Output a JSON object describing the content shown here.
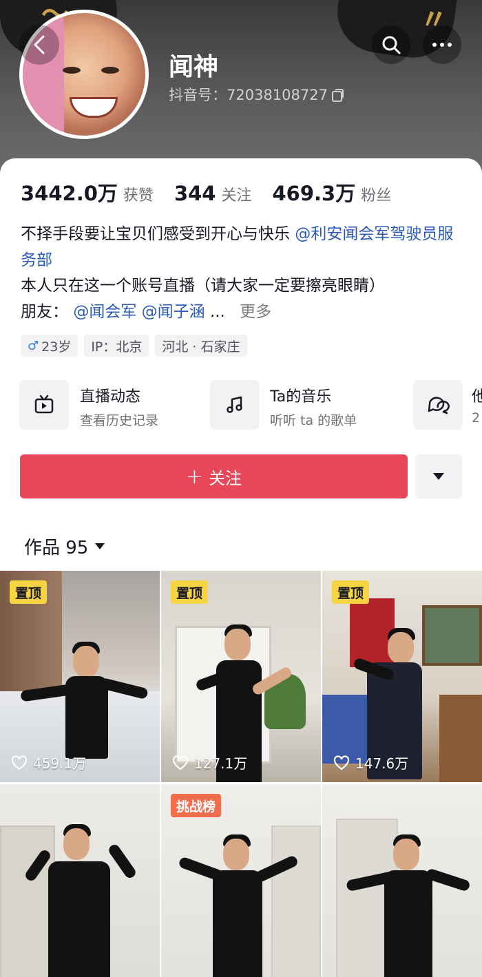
{
  "profile": {
    "name": "闻神",
    "douyin_id": "抖音号：72038108727"
  },
  "stats": [
    {
      "value": "3442.0万",
      "label": "获赞"
    },
    {
      "value": "344",
      "label": "关注"
    },
    {
      "value": "469.3万",
      "label": "粉丝"
    }
  ],
  "bio": {
    "line1_text": "不择手段要让宝贝们感受到开心与快乐",
    "line1_mention": "@利安闻会军驾驶员服务部",
    "line2": "本人只在这一个账号直播（请大家一定要擦亮眼睛）",
    "friends_label": "朋友：",
    "friend1": "@闻会军",
    "friend2": "@闻子涵",
    "ellipsis": "...",
    "more": "更多"
  },
  "tags": {
    "gender_icon": "♂",
    "age": "23岁",
    "ip": "IP：北京",
    "location": "河北 · 石家庄"
  },
  "features": [
    {
      "title": "直播动态",
      "subtitle": "查看历史记录",
      "icon": "tv-icon"
    },
    {
      "title": "Ta的音乐",
      "subtitle": "听听 ta 的歌单",
      "icon": "music-note-icon"
    },
    {
      "title": "他",
      "subtitle": "2",
      "icon": "chat-bubbles-icon"
    }
  ],
  "actions": {
    "follow_label": "关注",
    "follow_icon": "+"
  },
  "works": {
    "tab_label": "作品 95"
  },
  "videos": [
    {
      "badge": "置顶",
      "badge_type": "pinned",
      "likes": "459.1万"
    },
    {
      "badge": "置顶",
      "badge_type": "pinned",
      "likes": "127.1万"
    },
    {
      "badge": "置顶",
      "badge_type": "pinned",
      "likes": "147.6万"
    },
    {
      "badge": "",
      "badge_type": "none",
      "likes": ""
    },
    {
      "badge": "挑战榜",
      "badge_type": "challenge",
      "likes": ""
    },
    {
      "badge": "",
      "badge_type": "none",
      "likes": ""
    }
  ],
  "colors": {
    "follow_button": "#e8475a",
    "mention": "#2b5bb8",
    "pinned_badge": "#f7d443",
    "challenge_badge": "#f36c4d"
  }
}
